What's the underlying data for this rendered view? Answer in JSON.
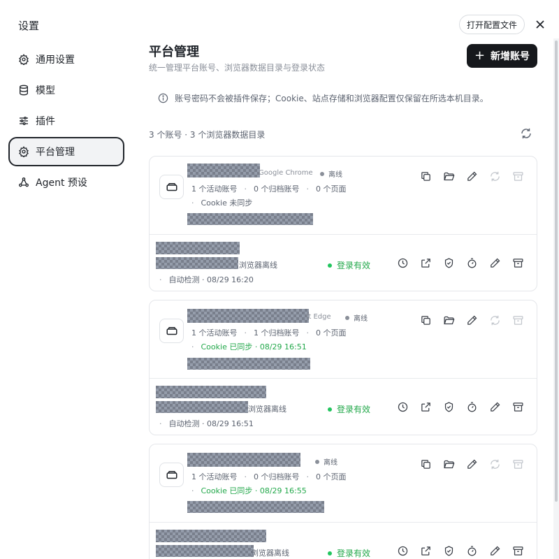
{
  "sidebar": {
    "title": "设置",
    "items": [
      {
        "label": "通用设置",
        "icon": "gear-icon"
      },
      {
        "label": "模型",
        "icon": "database-icon"
      },
      {
        "label": "插件",
        "icon": "sliders-icon"
      },
      {
        "label": "平台管理",
        "icon": "gear-icon",
        "active": true
      },
      {
        "label": "Agent 预设",
        "icon": "share-icon"
      }
    ]
  },
  "header": {
    "open_config_label": "打开配置文件",
    "title": "平台管理",
    "subtitle": "统一管理平台账号、浏览器数据目录与登录状态",
    "add_account_label": "新增账号"
  },
  "notice": "账号密码不会被插件保存；Cookie、站点存储和浏览器配置仅保留在所选本机目录。",
  "summary": "3 个账号 · 3 个浏览器数据目录",
  "profiles": [
    {
      "browser": "Google Chrome",
      "status": "离线",
      "active_accounts": "1 个活动账号",
      "archived_accounts": "0 个归档账号",
      "pages": "0 个页面",
      "cookie": "Cookie 未同步",
      "cookie_synced": false,
      "account": {
        "state": "浏览器离线",
        "login": "登录有效",
        "check": "自动检测 · 08/29 16:20"
      }
    },
    {
      "browser": "ft Edge",
      "status": "离线",
      "active_accounts": "1 个活动账号",
      "archived_accounts": "1 个归档账号",
      "pages": "0 个页面",
      "cookie": "Cookie 已同步 · 08/29 16:51",
      "cookie_synced": true,
      "account": {
        "state": "浏览器离线",
        "login": "登录有效",
        "check": "自动检测 · 08/29 16:51"
      }
    },
    {
      "browser": "",
      "status": "离线",
      "active_accounts": "1 个活动账号",
      "archived_accounts": "0 个归档账号",
      "pages": "0 个页面",
      "cookie": "Cookie 已同步 · 08/29 16:55",
      "cookie_synced": true,
      "account": {
        "state": "浏览器离线",
        "login": "登录有效",
        "check": ""
      }
    }
  ],
  "separator": "·",
  "colors": {
    "accent_dark": "#16181c",
    "success": "#22a84a",
    "muted": "#8a8f99"
  }
}
